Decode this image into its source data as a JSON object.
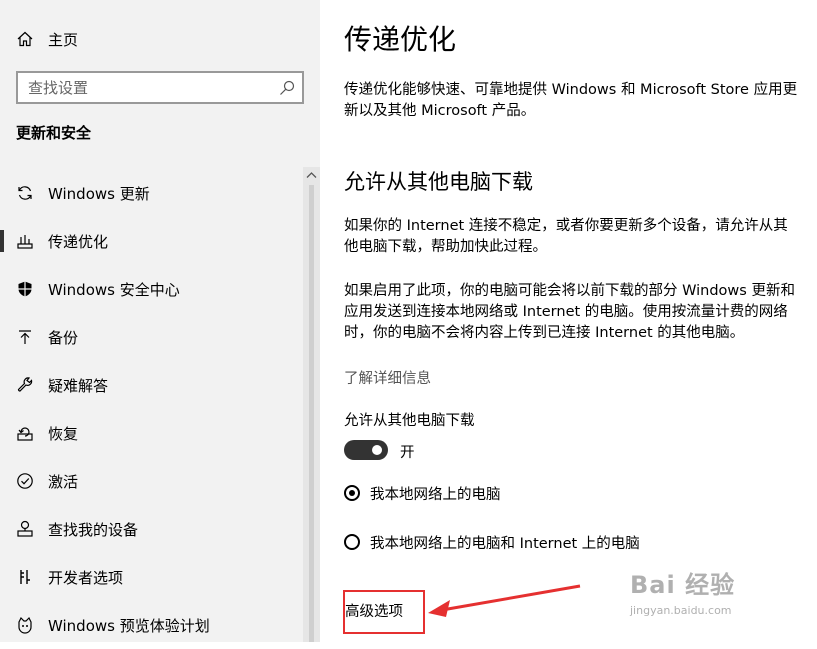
{
  "sidebar": {
    "home_label": "主页",
    "search_placeholder": "查找设置",
    "section_title": "更新和安全",
    "items": [
      {
        "label": "Windows 更新",
        "icon": "sync-icon"
      },
      {
        "label": "传递优化",
        "icon": "delivery-optimization-icon",
        "selected": true
      },
      {
        "label": "Windows 安全中心",
        "icon": "shield-icon"
      },
      {
        "label": "备份",
        "icon": "backup-arrow-icon"
      },
      {
        "label": "疑难解答",
        "icon": "wrench-icon"
      },
      {
        "label": "恢复",
        "icon": "recovery-icon"
      },
      {
        "label": "激活",
        "icon": "check-circle-icon"
      },
      {
        "label": "查找我的设备",
        "icon": "find-device-icon"
      },
      {
        "label": "开发者选项",
        "icon": "developer-icon"
      },
      {
        "label": "Windows 预览体验计划",
        "icon": "insider-icon"
      }
    ]
  },
  "main": {
    "title": "传递优化",
    "intro": "传递优化能够快速、可靠地提供 Windows 和 Microsoft Store 应用更新以及其他 Microsoft 产品。",
    "section_heading": "允许从其他电脑下载",
    "para1": "如果你的 Internet 连接不稳定，或者你要更新多个设备，请允许从其他电脑下载，帮助加快此过程。",
    "para2": "如果启用了此项，你的电脑可能会将以前下载的部分 Windows 更新和应用发送到连接本地网络或 Internet 的电脑。使用按流量计费的网络时，你的电脑不会将内容上传到已连接 Internet 的其他电脑。",
    "learn_more": "了解详细信息",
    "toggle_label": "允许从其他电脑下载",
    "toggle_state": "开",
    "toggle_on": true,
    "radio_options": [
      {
        "label": "我本地网络上的电脑",
        "selected": true
      },
      {
        "label": "我本地网络上的电脑和 Internet 上的电脑",
        "selected": false
      }
    ],
    "advanced_link": "高级选项"
  },
  "watermark": {
    "logo": "Bai 经验",
    "url": "jingyan.baidu.com"
  },
  "colors": {
    "sidebar_bg": "#f2f2f2",
    "highlight_box": "#e53030",
    "toggle_on": "#333333"
  }
}
